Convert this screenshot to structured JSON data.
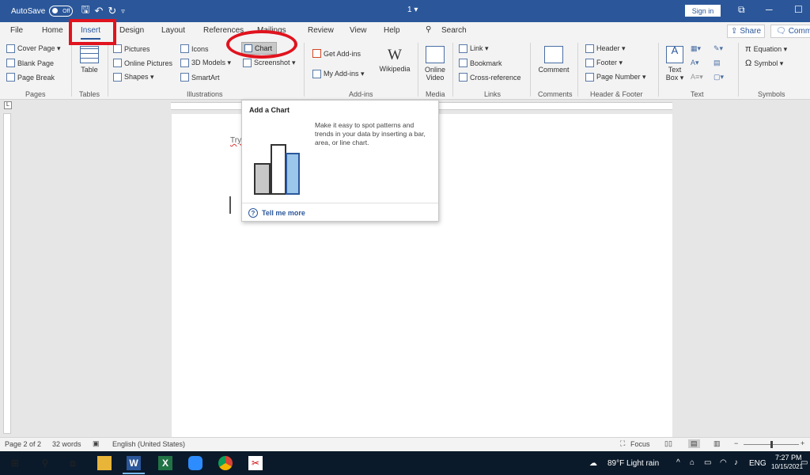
{
  "title_bar": {
    "autosave_label": "AutoSave",
    "autosave_state": "Off",
    "doc_title": "1 ▾",
    "sign_in": "Sign in"
  },
  "tabs": [
    "File",
    "Home",
    "Insert",
    "Design",
    "Layout",
    "References",
    "Mailings",
    "Review",
    "View",
    "Help"
  ],
  "search_label": "Search",
  "share_label": "Share",
  "comments_label": "Comm",
  "ribbon": {
    "pages": [
      "Cover Page ▾",
      "Blank Page",
      "Page Break"
    ],
    "table": "Table",
    "illus_left": [
      "Pictures",
      "Online Pictures",
      "Shapes ▾"
    ],
    "illus_mid": [
      "Icons",
      "3D Models ▾",
      "SmartArt"
    ],
    "chart": "Chart",
    "screenshot": "Screenshot ▾",
    "addins": [
      "Get Add-ins",
      "My Add-ins ▾"
    ],
    "wikipedia": "Wikipedia",
    "online_video": "Online Video",
    "links": [
      "Link ▾",
      "Bookmark",
      "Cross-reference"
    ],
    "comment": "Comment",
    "header_footer": [
      "Header ▾",
      "Footer ▾",
      "Page Number ▾"
    ],
    "text_box": "Text Box ▾",
    "symbols": [
      "Equation ▾",
      "Symbol ▾"
    ],
    "groups": [
      "Pages",
      "Tables",
      "Illustrations",
      "Add-ins",
      "Media",
      "Links",
      "Comments",
      "Header & Footer",
      "Text",
      "Symbols"
    ]
  },
  "tooltip": {
    "title": "Add a Chart",
    "description": "Make it easy to spot patterns and trends in your data by inserting a bar, area, or line chart.",
    "tell_more": "Tell me more"
  },
  "document": {
    "partial_text": "Try"
  },
  "status": {
    "page": "Page 2 of 2",
    "words": "32 words",
    "language": "English (United States)",
    "focus": "Focus"
  },
  "taskbar": {
    "weather": "89°F  Light rain",
    "lang": "ENG",
    "time": "7:27 PM",
    "date": "10/15/2021"
  },
  "colors": {
    "accent": "#2b579a",
    "highlight_red": "#e0131e"
  }
}
